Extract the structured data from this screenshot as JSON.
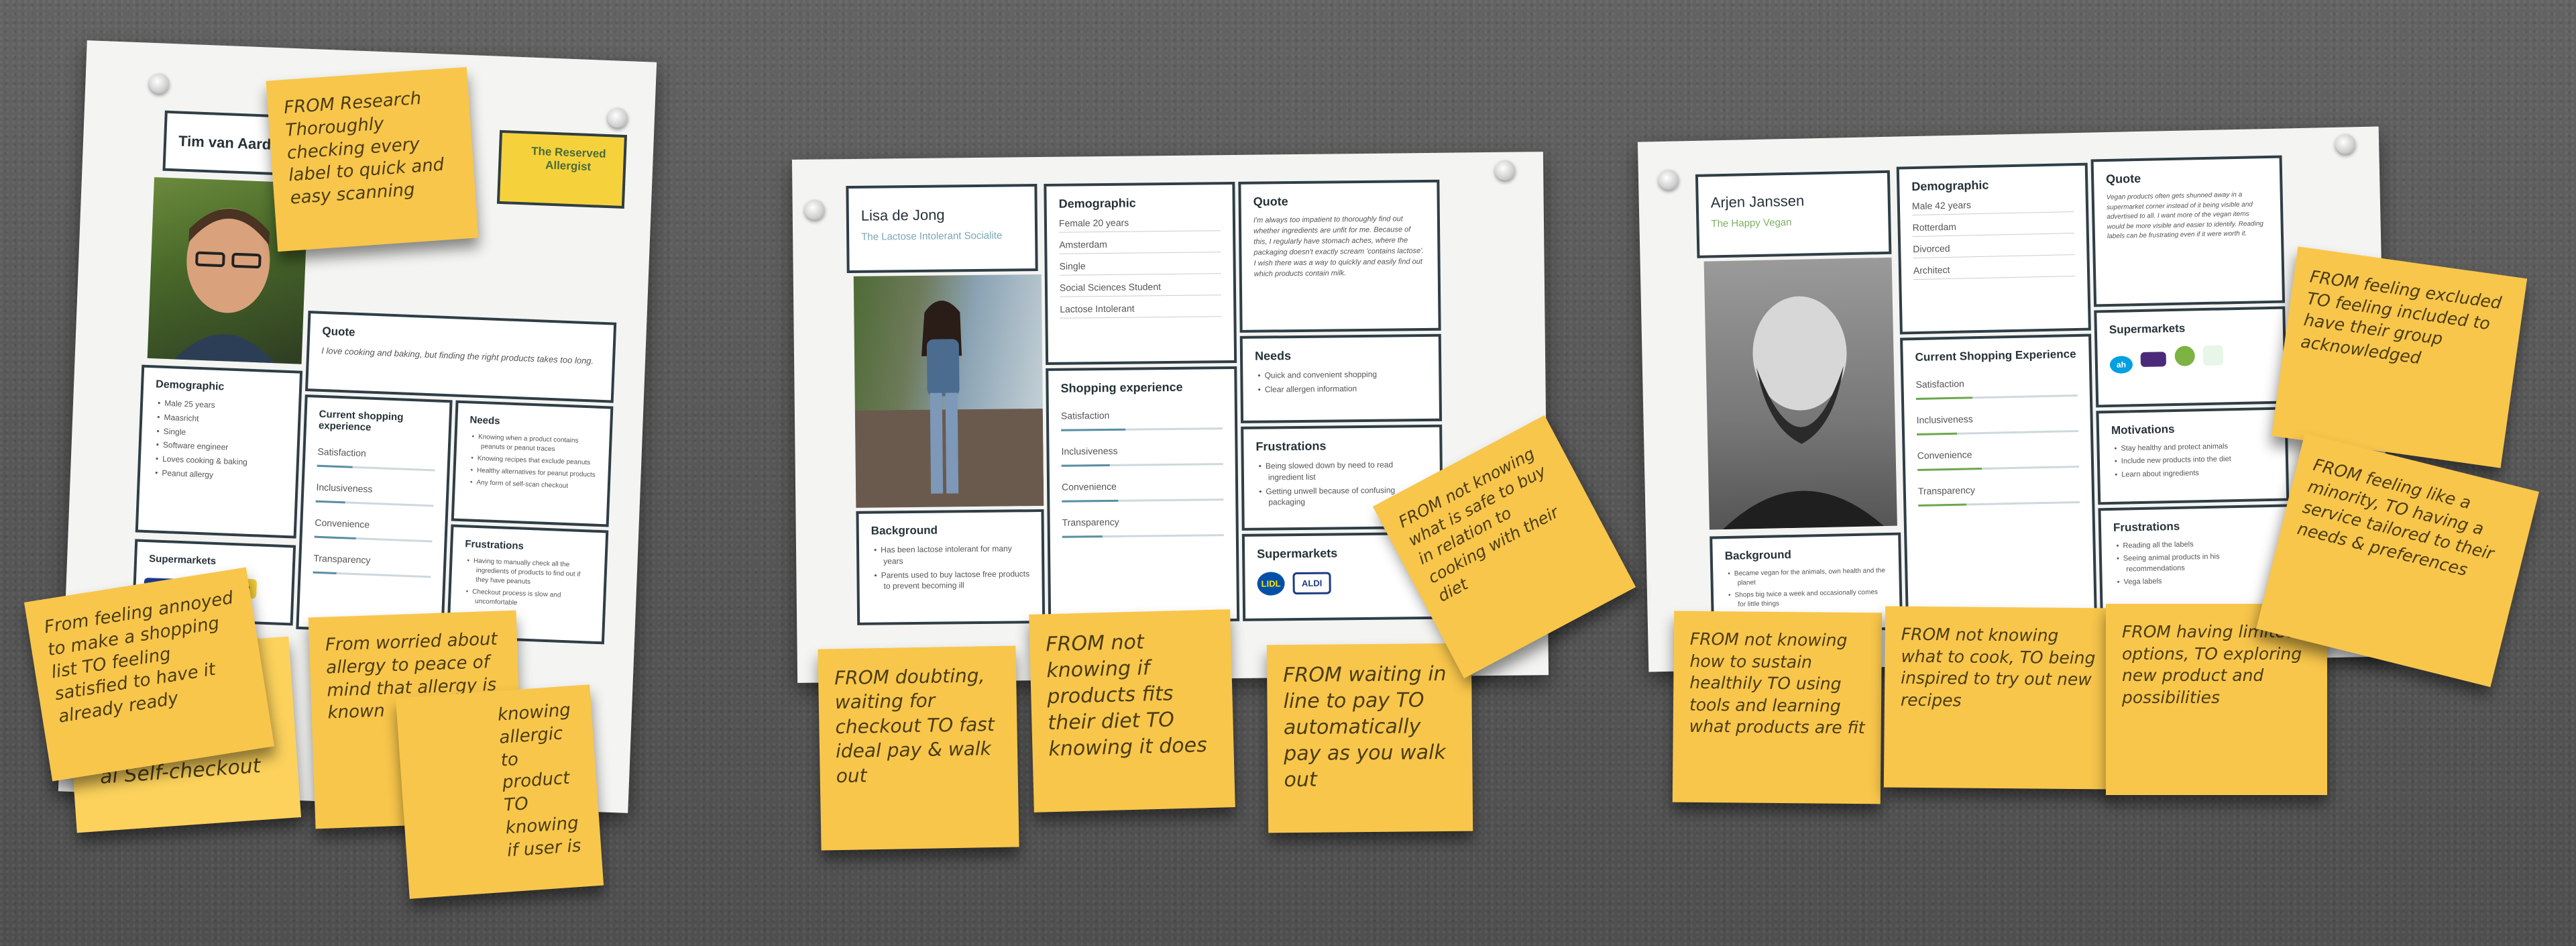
{
  "persona1": {
    "name": "Tim van Aard",
    "tag": "The Reserved Allergist",
    "quote_title": "Quote",
    "quote": "I love cooking and baking, but finding the right products takes too long.",
    "demographic_title": "Demographic",
    "demographic": [
      "Male 25 years",
      "Maasricht",
      "Single",
      "Software engineer",
      "Loves cooking & baking",
      "Peanut allergy"
    ],
    "experience_title": "Current shopping experience",
    "metrics": [
      "Satisfaction",
      "Inclusiveness",
      "Convenience",
      "Transparency"
    ],
    "needs_title": "Needs",
    "needs": [
      "Knowing when a product contains peanuts or peanut traces",
      "Knowing recipes that exclude peanuts",
      "Healthy alternatives for peanut products",
      "Any form of self-scan checkout"
    ],
    "frustrations_title": "Frustrations",
    "frustrations": [
      "Having to manually check all the ingredients of products to find out if they have peanuts",
      "Checkout process is slow and uncomfortable"
    ],
    "supermarkets_title": "Supermarkets",
    "supermarkets": [
      "Jan Linders",
      "JUMBO"
    ]
  },
  "persona2": {
    "name": "Lisa de Jong",
    "tag": "The Lactose Intolerant Socialite",
    "demographic_title": "Demographic",
    "demographic": [
      "Female 20 years",
      "Amsterdam",
      "Single",
      "Social Sciences Student",
      "Lactose Intolerant"
    ],
    "quote_title": "Quote",
    "quote": "I'm always too impatient to thoroughly find out whether ingredients are unfit for me. Because of this, I regularly have stomach aches, where the packaging doesn't exactly scream 'contains lactose'. I wish there was a way to quickly and easily find out which products contain milk.",
    "experience_title": "Shopping experience",
    "metrics": [
      "Satisfaction",
      "Inclusiveness",
      "Convenience",
      "Transparency"
    ],
    "needs_title": "Needs",
    "needs": [
      "Quick and convenient shopping",
      "Clear allergen information"
    ],
    "frustrations_title": "Frustrations",
    "frustrations": [
      "Being slowed down by need to read ingredient list",
      "Getting unwell because of confusing packaging"
    ],
    "supermarkets_title": "Supermarkets",
    "supermarkets": [
      "LIDL",
      "ALDI"
    ],
    "background_title": "Background",
    "background": [
      "Has been lactose intolerant for many years",
      "Parents used to buy lactose free products to prevent becoming ill"
    ]
  },
  "persona3": {
    "name": "Arjen Janssen",
    "tag": "The Happy Vegan",
    "demographic_title": "Demographic",
    "demographic": [
      "Male 42 years",
      "Rotterdam",
      "Divorced",
      "Architect"
    ],
    "quote_title": "Quote",
    "quote": "Vegan products often gets shunned away in a supermarket corner instead of it being visible and advertised to all. I want more of the vegan items would be more visible and easier to identify. Reading labels can be frustrating even if it were worth it.",
    "experience_title": "Current Shopping Experience",
    "metrics": [
      "Satisfaction",
      "Inclusiveness",
      "Convenience",
      "Transparency"
    ],
    "supermarkets_title": "Supermarkets",
    "motivations_title": "Motivations",
    "motivations": [
      "Stay healthy and protect animals",
      "Include new products into the diet",
      "Learn about ingredients"
    ],
    "frustrations_title": "Frustrations",
    "frustrations": [
      "Reading all the labels",
      "Seeing animal products in his recommendations",
      "Vega labels"
    ],
    "background_title": "Background",
    "background": [
      "Became vegan for the animals, own health and the planet",
      "Shops big twice a week and occasionally comes for little things"
    ]
  },
  "notes": {
    "n1": "FROM Research Thoroughly checking every label to quick and easy scanning",
    "n2": "From feeling annoyed to make a shopping list TO feeling satisfied to have it already ready",
    "n3": "al Self-checkout",
    "n4": "From worried about allergy to peace of mind that allergy is known",
    "n5": "knowing allergic to product TO knowing if user is",
    "n6": "FROM doubting, waiting for checkout TO fast ideal pay & walk out",
    "n7": "FROM not knowing if products fits their diet TO knowing it does",
    "n8": "FROM waiting in line to pay TO automatically pay as you walk out",
    "n9": "FROM not knowing what is safe to buy in relation to cooking with their diet",
    "n10": "FROM not knowing how to sustain healthily TO using tools and learning what products are fit",
    "n11": "FROM not knowing what to cook, TO being inspired to try out new recipes",
    "n12": "FROM having limited options, TO exploring new product and possibilities",
    "n13": "FROM feeling excluded TO feeling included to have their group acknowledged",
    "n14": "FROM feeling like a minority, TO having a service tailored to their needs & preferences"
  }
}
